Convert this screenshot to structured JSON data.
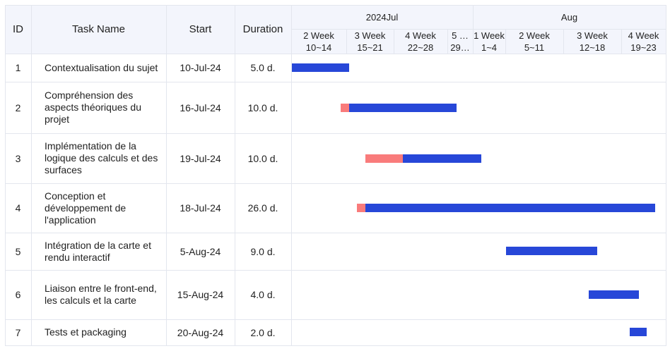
{
  "table": {
    "columns": {
      "id": "ID",
      "task": "Task Name",
      "start": "Start",
      "duration": "Duration"
    },
    "months": [
      "2024Jul",
      "Aug"
    ],
    "weeks": [
      {
        "week": "2 Week",
        "days": "10~14"
      },
      {
        "week": "3 Week",
        "days": "15~21"
      },
      {
        "week": "4 Week",
        "days": "22~28"
      },
      {
        "week": "5 …",
        "days": "29…"
      },
      {
        "week": "1 Week",
        "days": "1~4"
      },
      {
        "week": "2 Week",
        "days": "5~11"
      },
      {
        "week": "3 Week",
        "days": "12~18"
      },
      {
        "week": "4 Week",
        "days": "19~23"
      }
    ],
    "rows": [
      {
        "id": "1",
        "name": "Contextualisation du sujet",
        "start": "10-Jul-24",
        "duration": "5.0 d."
      },
      {
        "id": "2",
        "name": "Compréhension des aspects théoriques du projet",
        "start": "16-Jul-24",
        "duration": "10.0 d."
      },
      {
        "id": "3",
        "name": "Implémentation de la logique des calculs et des surfaces",
        "start": "19-Jul-24",
        "duration": "10.0 d."
      },
      {
        "id": "4",
        "name": "Conception et développement de l'application",
        "start": "18-Jul-24",
        "duration": "26.0 d."
      },
      {
        "id": "5",
        "name": "Intégration de la carte et rendu interactif",
        "start": "5-Aug-24",
        "duration": "9.0 d."
      },
      {
        "id": "6",
        "name": "Liaison entre le front-end, les calculs et la carte",
        "start": "15-Aug-24",
        "duration": "4.0 d."
      },
      {
        "id": "7",
        "name": "Tests et packaging",
        "start": "20-Aug-24",
        "duration": "2.0 d."
      }
    ]
  },
  "colors": {
    "planned_bar": "#2747d8",
    "delay_bar": "#f97b7b",
    "header_bg": "#f3f5fc",
    "grid": "#e3e6ee"
  }
}
